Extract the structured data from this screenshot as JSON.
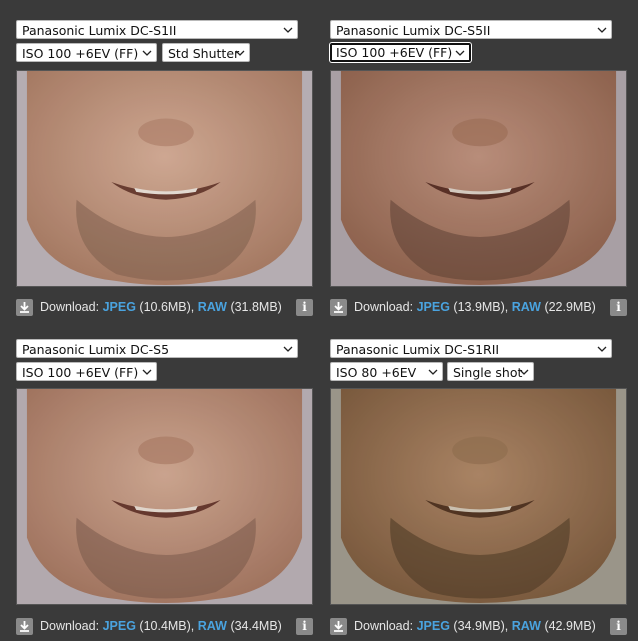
{
  "panels": [
    {
      "camera": "Panasonic Lumix DC-S1II",
      "iso": "ISO 100 +6EV (FF)",
      "shutter": "Std Shutter",
      "download_label": "Download:",
      "jpeg_label": "JPEG",
      "jpeg_size": "(10.6MB),",
      "raw_label": "RAW",
      "raw_size": "(31.8MB)",
      "info_label": "i"
    },
    {
      "camera": "Panasonic Lumix DC-S5II",
      "iso": "ISO 100 +6EV (FF)",
      "download_label": "Download:",
      "jpeg_label": "JPEG",
      "jpeg_size": "(13.9MB),",
      "raw_label": "RAW",
      "raw_size": "(22.9MB)",
      "info_label": "i"
    },
    {
      "camera": "Panasonic Lumix DC-S5",
      "iso": "ISO 100 +6EV (FF)",
      "download_label": "Download:",
      "jpeg_label": "JPEG",
      "jpeg_size": "(10.4MB),",
      "raw_label": "RAW",
      "raw_size": "(34.4MB)",
      "info_label": "i"
    },
    {
      "camera": "Panasonic Lumix DC-S1RII",
      "iso": "ISO 80 +6EV",
      "shutter": "Single shot",
      "download_label": "Download:",
      "jpeg_label": "JPEG",
      "jpeg_size": "(34.9MB),",
      "raw_label": "RAW",
      "raw_size": "(42.9MB)",
      "info_label": "i"
    }
  ],
  "colors": {
    "background": "#3a3a3a",
    "accent": "#4aa3df",
    "icon_button": "#8a8a8a"
  },
  "icons": [
    "chevron-down-icon",
    "download-icon",
    "info-icon"
  ]
}
